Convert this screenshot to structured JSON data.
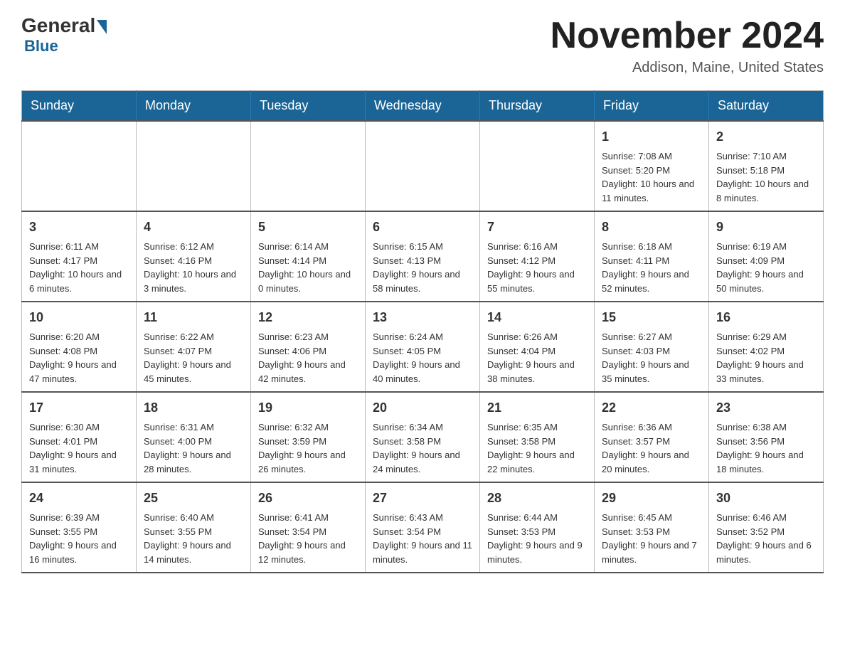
{
  "header": {
    "logo_general": "General",
    "logo_blue": "Blue",
    "month_title": "November 2024",
    "location": "Addison, Maine, United States"
  },
  "weekdays": [
    "Sunday",
    "Monday",
    "Tuesday",
    "Wednesday",
    "Thursday",
    "Friday",
    "Saturday"
  ],
  "weeks": [
    [
      {
        "day": "",
        "info": ""
      },
      {
        "day": "",
        "info": ""
      },
      {
        "day": "",
        "info": ""
      },
      {
        "day": "",
        "info": ""
      },
      {
        "day": "",
        "info": ""
      },
      {
        "day": "1",
        "info": "Sunrise: 7:08 AM\nSunset: 5:20 PM\nDaylight: 10 hours and 11 minutes."
      },
      {
        "day": "2",
        "info": "Sunrise: 7:10 AM\nSunset: 5:18 PM\nDaylight: 10 hours and 8 minutes."
      }
    ],
    [
      {
        "day": "3",
        "info": "Sunrise: 6:11 AM\nSunset: 4:17 PM\nDaylight: 10 hours and 6 minutes."
      },
      {
        "day": "4",
        "info": "Sunrise: 6:12 AM\nSunset: 4:16 PM\nDaylight: 10 hours and 3 minutes."
      },
      {
        "day": "5",
        "info": "Sunrise: 6:14 AM\nSunset: 4:14 PM\nDaylight: 10 hours and 0 minutes."
      },
      {
        "day": "6",
        "info": "Sunrise: 6:15 AM\nSunset: 4:13 PM\nDaylight: 9 hours and 58 minutes."
      },
      {
        "day": "7",
        "info": "Sunrise: 6:16 AM\nSunset: 4:12 PM\nDaylight: 9 hours and 55 minutes."
      },
      {
        "day": "8",
        "info": "Sunrise: 6:18 AM\nSunset: 4:11 PM\nDaylight: 9 hours and 52 minutes."
      },
      {
        "day": "9",
        "info": "Sunrise: 6:19 AM\nSunset: 4:09 PM\nDaylight: 9 hours and 50 minutes."
      }
    ],
    [
      {
        "day": "10",
        "info": "Sunrise: 6:20 AM\nSunset: 4:08 PM\nDaylight: 9 hours and 47 minutes."
      },
      {
        "day": "11",
        "info": "Sunrise: 6:22 AM\nSunset: 4:07 PM\nDaylight: 9 hours and 45 minutes."
      },
      {
        "day": "12",
        "info": "Sunrise: 6:23 AM\nSunset: 4:06 PM\nDaylight: 9 hours and 42 minutes."
      },
      {
        "day": "13",
        "info": "Sunrise: 6:24 AM\nSunset: 4:05 PM\nDaylight: 9 hours and 40 minutes."
      },
      {
        "day": "14",
        "info": "Sunrise: 6:26 AM\nSunset: 4:04 PM\nDaylight: 9 hours and 38 minutes."
      },
      {
        "day": "15",
        "info": "Sunrise: 6:27 AM\nSunset: 4:03 PM\nDaylight: 9 hours and 35 minutes."
      },
      {
        "day": "16",
        "info": "Sunrise: 6:29 AM\nSunset: 4:02 PM\nDaylight: 9 hours and 33 minutes."
      }
    ],
    [
      {
        "day": "17",
        "info": "Sunrise: 6:30 AM\nSunset: 4:01 PM\nDaylight: 9 hours and 31 minutes."
      },
      {
        "day": "18",
        "info": "Sunrise: 6:31 AM\nSunset: 4:00 PM\nDaylight: 9 hours and 28 minutes."
      },
      {
        "day": "19",
        "info": "Sunrise: 6:32 AM\nSunset: 3:59 PM\nDaylight: 9 hours and 26 minutes."
      },
      {
        "day": "20",
        "info": "Sunrise: 6:34 AM\nSunset: 3:58 PM\nDaylight: 9 hours and 24 minutes."
      },
      {
        "day": "21",
        "info": "Sunrise: 6:35 AM\nSunset: 3:58 PM\nDaylight: 9 hours and 22 minutes."
      },
      {
        "day": "22",
        "info": "Sunrise: 6:36 AM\nSunset: 3:57 PM\nDaylight: 9 hours and 20 minutes."
      },
      {
        "day": "23",
        "info": "Sunrise: 6:38 AM\nSunset: 3:56 PM\nDaylight: 9 hours and 18 minutes."
      }
    ],
    [
      {
        "day": "24",
        "info": "Sunrise: 6:39 AM\nSunset: 3:55 PM\nDaylight: 9 hours and 16 minutes."
      },
      {
        "day": "25",
        "info": "Sunrise: 6:40 AM\nSunset: 3:55 PM\nDaylight: 9 hours and 14 minutes."
      },
      {
        "day": "26",
        "info": "Sunrise: 6:41 AM\nSunset: 3:54 PM\nDaylight: 9 hours and 12 minutes."
      },
      {
        "day": "27",
        "info": "Sunrise: 6:43 AM\nSunset: 3:54 PM\nDaylight: 9 hours and 11 minutes."
      },
      {
        "day": "28",
        "info": "Sunrise: 6:44 AM\nSunset: 3:53 PM\nDaylight: 9 hours and 9 minutes."
      },
      {
        "day": "29",
        "info": "Sunrise: 6:45 AM\nSunset: 3:53 PM\nDaylight: 9 hours and 7 minutes."
      },
      {
        "day": "30",
        "info": "Sunrise: 6:46 AM\nSunset: 3:52 PM\nDaylight: 9 hours and 6 minutes."
      }
    ]
  ]
}
